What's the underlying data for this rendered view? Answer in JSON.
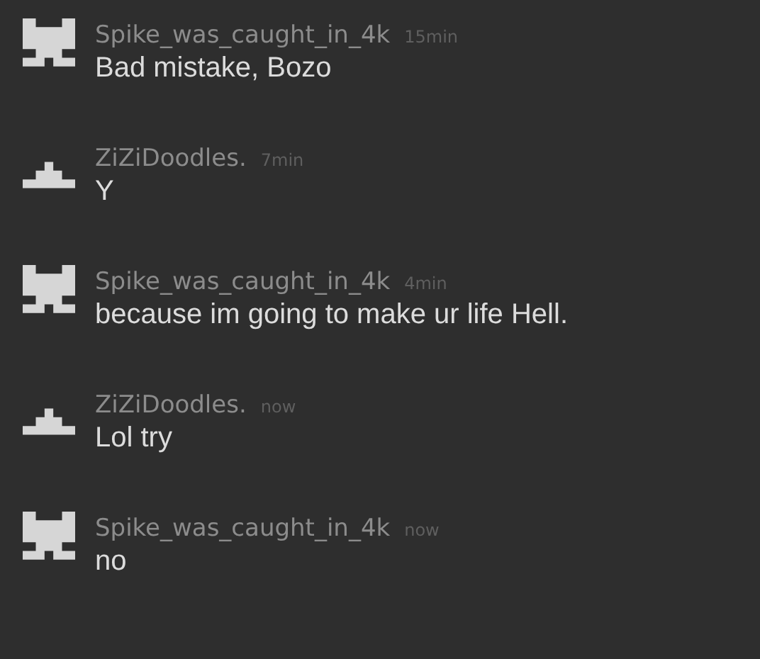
{
  "messages": [
    {
      "kind": "blocky",
      "author": "Spike_was_caught_in_4k",
      "time": "15min",
      "text": "Bad mistake, Bozo"
    },
    {
      "kind": "pyramid",
      "author": "ZiZiDoodles.",
      "time": "7min",
      "text": "Y"
    },
    {
      "kind": "blocky",
      "author": "Spike_was_caught_in_4k",
      "time": "4min",
      "text": "because im going to make ur life Hell."
    },
    {
      "kind": "pyramid",
      "author": "ZiZiDoodles.",
      "time": "now",
      "text": "Lol try"
    },
    {
      "kind": "blocky",
      "author": "Spike_was_caught_in_4k",
      "time": "now",
      "text": "no"
    }
  ]
}
